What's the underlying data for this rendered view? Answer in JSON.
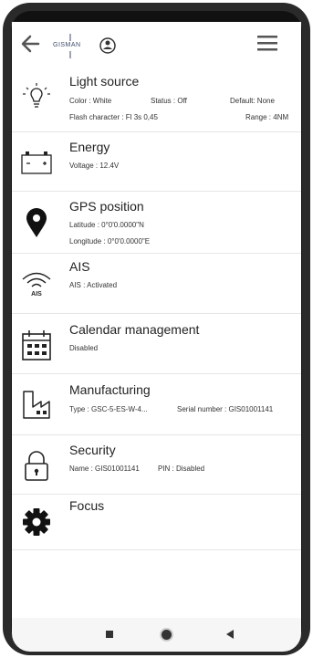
{
  "app": {
    "brand": "GISMAN"
  },
  "items": [
    {
      "title": "Light source",
      "color": "Color : White",
      "status": "Status : Off",
      "default": "Default: None",
      "flash": "Flash character : Fl 3s 0,45",
      "range": "Range : 4NM"
    },
    {
      "title": "Energy",
      "voltage": "Voltage : 12.4V"
    },
    {
      "title": "GPS position",
      "latitude": "Latitude : 0°0'0.0000\"N",
      "longitude": "Longitude : 0°0'0.0000\"E"
    },
    {
      "title": "AIS",
      "ais": "AIS : Activated",
      "icon_label": "AIS"
    },
    {
      "title": "Calendar management",
      "state": "Disabled"
    },
    {
      "title": "Manufacturing",
      "type": "Type : GSC-5-ES-W-4...",
      "serial": "Serial number : GIS01001141"
    },
    {
      "title": "Security",
      "name": "Name : GIS01001141",
      "pin": "PIN : Disabled"
    },
    {
      "title": "Focus"
    }
  ],
  "icons": [
    "back-arrow-icon",
    "hamburger-menu-icon",
    "light-bulb-icon",
    "battery-icon",
    "location-pin-icon",
    "wireless-icon",
    "calendar-icon",
    "factory-icon",
    "padlock-icon",
    "gear-icon",
    "square-icon",
    "circle-icon",
    "triangle-back-icon"
  ],
  "colors": {
    "background": "#ffffff",
    "divider": "#e6e6e6",
    "phone_frame": "#2a2a2a",
    "brand": "#3c4a6a"
  }
}
